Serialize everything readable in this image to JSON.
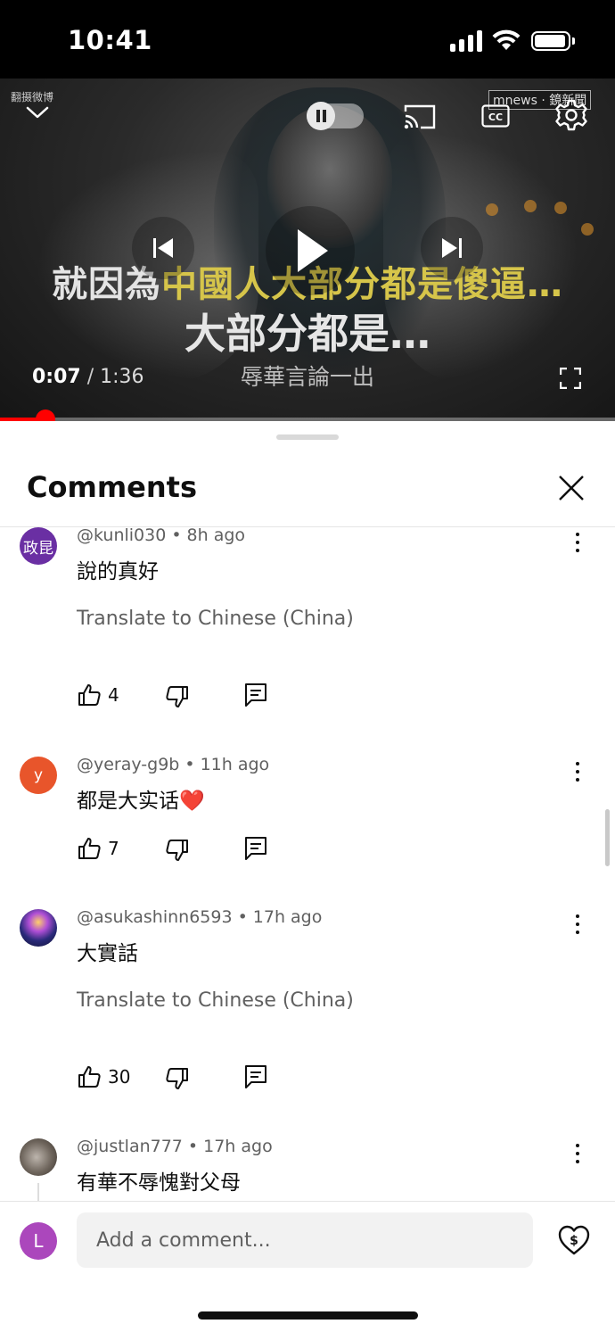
{
  "status_bar": {
    "time": "10:41"
  },
  "player": {
    "watermark_left": "翻摄微博",
    "watermark_right": "mnews · 鏡新聞",
    "subtitle_line1_a": "就因為",
    "subtitle_line1_b": "中國人大部分都是傻逼…",
    "subtitle_line2": "大部分都是…",
    "subtitle_line3": "辱華言論一出",
    "time_current": "0:07",
    "time_sep": " / ",
    "time_total": "1:36",
    "progress_fraction": 0.074,
    "accent_color": "#ff0000"
  },
  "comments_panel": {
    "title": "Comments",
    "composer_placeholder": "Add a comment...",
    "composer_avatar_letter": "L"
  },
  "comments": [
    {
      "avatar_text": "政昆",
      "avatar_color": "#6a2fa3",
      "author": "@kunli030",
      "time": "8h ago",
      "text": "說的真好",
      "translate": "Translate to Chinese (China)",
      "likes": "4"
    },
    {
      "avatar_text": "y",
      "avatar_color": "#e8552b",
      "author": "@yeray-g9b",
      "time": "11h ago",
      "text": "都是大实话❤️",
      "translate": "",
      "likes": "7"
    },
    {
      "avatar_text": "",
      "avatar_color": "#2b2b6b",
      "author": "@asukashinn6593",
      "time": "17h ago",
      "text": "大實話",
      "translate": "Translate to Chinese (China)",
      "likes": "30"
    },
    {
      "avatar_text": "",
      "avatar_color": "#7a6f66",
      "author": "@justlan777",
      "time": "17h ago",
      "text": "有華不辱愧對父母",
      "translate": "",
      "likes": ""
    }
  ]
}
